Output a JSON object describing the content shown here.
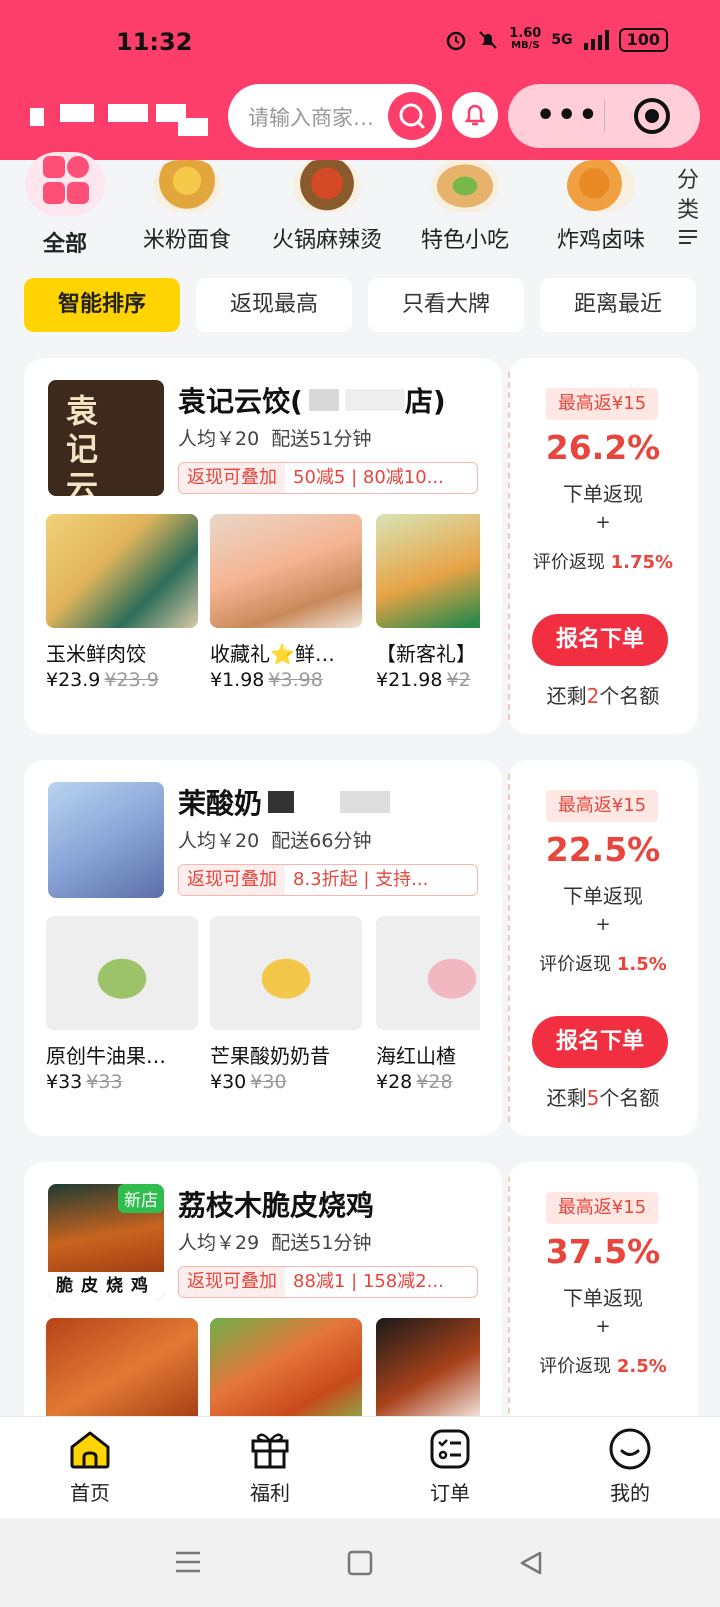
{
  "status_bar": {
    "time": "11:32",
    "network_speed": "1.60",
    "network_unit": "MB/S",
    "signal": "5G",
    "battery": "100"
  },
  "header": {
    "search_placeholder": "请输入商家…"
  },
  "categories": [
    {
      "label": "全部",
      "icon": "grid-icon"
    },
    {
      "label": "米粉面食",
      "icon": "noodle-icon"
    },
    {
      "label": "火锅麻辣烫",
      "icon": "hotpot-icon"
    },
    {
      "label": "特色小吃",
      "icon": "wrap-icon"
    },
    {
      "label": "炸鸡卤味",
      "icon": "fried-chicken-icon"
    }
  ],
  "category_more": "分类",
  "sort_tabs": [
    "智能排序",
    "返现最高",
    "只看大牌",
    "距离最近"
  ],
  "stores": [
    {
      "name": "袁记云饺(",
      "name_suffix": "店)",
      "logo_text": "袁记云饺",
      "avg_price": "人均￥20",
      "delivery": "配送51分钟",
      "promo_tag": "返现可叠加",
      "promo_text": "50减5 | 80减10...",
      "dishes": [
        {
          "name": "玉米鲜肉饺",
          "price": "¥23.9",
          "orig": "¥23.9"
        },
        {
          "name": "收藏礼⭐鲜…",
          "price": "¥1.98",
          "orig": "¥3.98"
        },
        {
          "name": "【新客礼】",
          "price": "¥21.98",
          "orig": "¥2"
        }
      ],
      "max_return": "最高返¥15",
      "percent": "26.2%",
      "order_return": "下单返现",
      "plus": "+",
      "eval_label": "评价返现",
      "eval_percent": "1.75%",
      "signup": "报名下单",
      "remain_pre": "还剩",
      "remain_num": "2",
      "remain_post": "个名额"
    },
    {
      "name": "茉酸奶",
      "name_suffix": "",
      "logo_text": "",
      "avg_price": "人均￥20",
      "delivery": "配送66分钟",
      "promo_tag": "返现可叠加",
      "promo_text": "8.3折起 | 支持...",
      "dishes": [
        {
          "name": "原创牛油果…",
          "price": "¥33",
          "orig": "¥33"
        },
        {
          "name": "芒果酸奶奶昔",
          "price": "¥30",
          "orig": "¥30"
        },
        {
          "name": "海红山楂",
          "price": "¥28",
          "orig": "¥28"
        }
      ],
      "max_return": "最高返¥15",
      "percent": "22.5%",
      "order_return": "下单返现",
      "plus": "+",
      "eval_label": "评价返现",
      "eval_percent": "1.5%",
      "signup": "报名下单",
      "remain_pre": "还剩",
      "remain_num": "5",
      "remain_post": "个名额"
    },
    {
      "name": "荔枝木脆皮烧鸡",
      "name_suffix": "",
      "new_tag": "新店",
      "logo_text": "脆皮烧鸡",
      "avg_price": "人均￥29",
      "delivery": "配送51分钟",
      "promo_tag": "返现可叠加",
      "promo_text": "88减1 | 158减2...",
      "max_return": "最高返¥15",
      "percent": "37.5%",
      "order_return": "下单返现",
      "plus": "+",
      "eval_label": "评价返现",
      "eval_percent": "2.5%"
    }
  ],
  "bottom_nav": [
    {
      "label": "首页",
      "icon": "home-icon"
    },
    {
      "label": "福利",
      "icon": "gift-icon"
    },
    {
      "label": "订单",
      "icon": "order-list-icon"
    },
    {
      "label": "我的",
      "icon": "profile-icon"
    }
  ],
  "colors": {
    "header": "#fe3e6a",
    "accent_red": "#e8453c",
    "active_tab": "#ffd400",
    "signup_button": "#f22f41"
  }
}
